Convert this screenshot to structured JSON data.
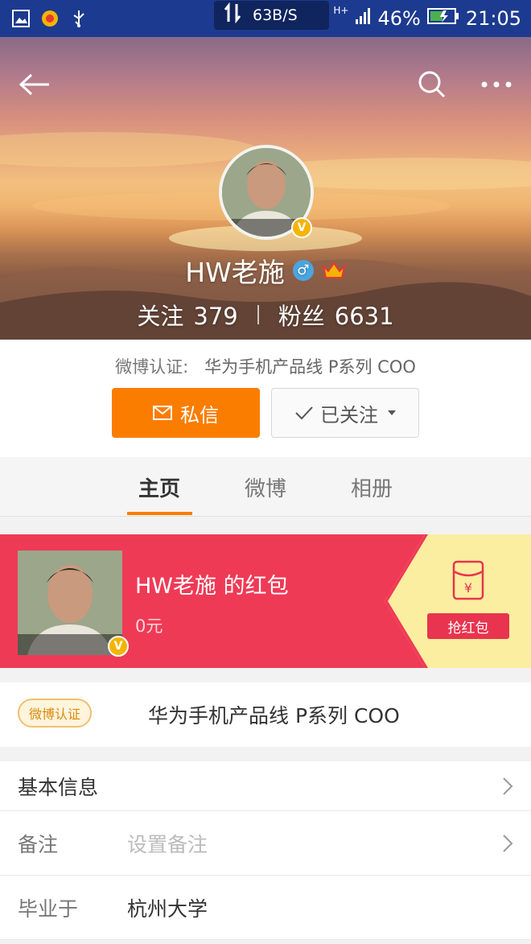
{
  "status_bar": {
    "net_speed": "63B/S",
    "signal_type": "H+",
    "battery": "46%",
    "time": "21:05"
  },
  "profile": {
    "name": "HW老施",
    "gender_symbol": "♂",
    "verified_badge": "V",
    "following_label": "关注",
    "following_count": "379",
    "followers_label": "粉丝",
    "followers_count": "6631"
  },
  "verify": {
    "label": "微博认证:",
    "value": "华为手机产品线 P系列  COO"
  },
  "actions": {
    "message_label": "私信",
    "followed_label": "已关注"
  },
  "tabs": [
    {
      "label": "主页",
      "active": true
    },
    {
      "label": "微博",
      "active": false
    },
    {
      "label": "相册",
      "active": false
    }
  ],
  "red_packet": {
    "title": "HW老施 的红包",
    "amount": "0元",
    "grab_label": "抢红包",
    "yuan_symbol": "¥"
  },
  "verify_card": {
    "tag": "微博认证",
    "text": "华为手机产品线 P系列  COO"
  },
  "info_rows": [
    {
      "label": "基本信息",
      "value": "",
      "has_arrow": true
    },
    {
      "label": "备注",
      "value": "设置备注",
      "has_arrow": true
    },
    {
      "label": "毕业于",
      "value": "杭州大学",
      "has_arrow": false
    }
  ],
  "colors": {
    "accent": "#fa7d00",
    "red_packet": "#ef3a56",
    "status_bar": "#1c3a8f"
  }
}
